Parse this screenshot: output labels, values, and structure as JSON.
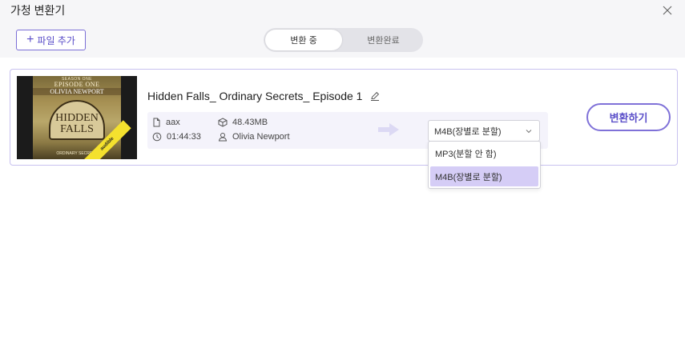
{
  "window": {
    "title": "가청 변환기",
    "close_icon": "close-icon"
  },
  "toolbar": {
    "add_file_label": "파일 추가",
    "add_icon": "plus-icon"
  },
  "tabs": [
    {
      "label": "변환 중",
      "active": true
    },
    {
      "label": "변환완료",
      "active": false
    }
  ],
  "item": {
    "cover": {
      "season": "SEASON ONE",
      "episode": "EPISODE ONE",
      "author": "OLIVIA NEWPORT",
      "title_line1": "HIDDEN",
      "title_line2": "FALLS",
      "series": "ORDINARY SECRETS",
      "badge": "audible"
    },
    "title": "Hidden Falls_ Ordinary Secrets_ Episode 1",
    "format": "aax",
    "size": "48.43MB",
    "duration": "01:44:33",
    "author": "Olivia Newport",
    "selected_output": "M4B(장별로 분할)",
    "convert_label": "변환하기"
  },
  "dropdown": {
    "options": [
      "MP3(분할 안 함)",
      "M4B(장별로 분할)"
    ],
    "highlighted_index": 1
  },
  "colors": {
    "accent": "#5b4fc9",
    "accent_border": "#7f71d8",
    "highlight": "#d5cdf6",
    "panel_bg": "#f4f3fb"
  }
}
